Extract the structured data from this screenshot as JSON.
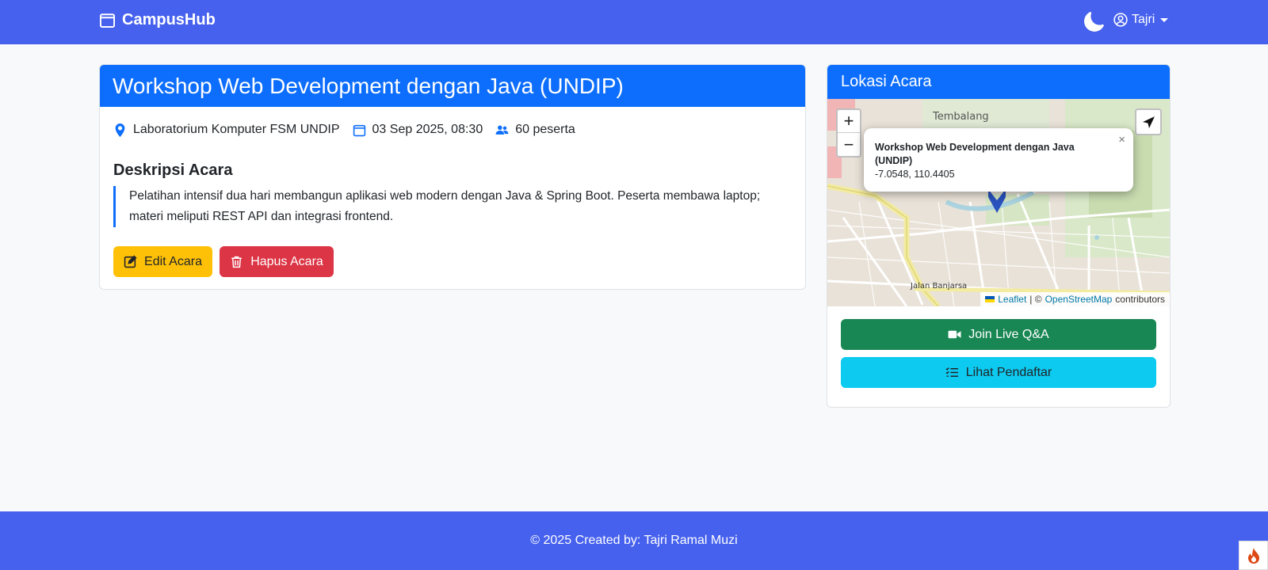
{
  "navbar": {
    "brand": "CampusHub",
    "brand_icon": "calendar-icon",
    "theme_icon": "moon-icon",
    "user_name": "Tajri",
    "user_icon": "user-circle-icon",
    "bg_color": "#4661ee"
  },
  "event": {
    "title": "Workshop Web Development dengan Java (UNDIP)",
    "location": "Laboratorium Komputer FSM UNDIP",
    "datetime": "03 Sep 2025, 08:30",
    "participants": "60 peserta",
    "description_title": "Deskripsi Acara",
    "description": "Pelatihan intensif dua hari membangun aplikasi web modern dengan Java & Spring Boot. Peserta membawa laptop; materi meliputi REST API dan integrasi frontend.",
    "edit_label": "Edit Acara",
    "delete_label": "Hapus Acara",
    "accent": "#0d6efd"
  },
  "location_card": {
    "title": "Lokasi Acara",
    "map": {
      "zoom_in": "+",
      "zoom_out": "−",
      "area_label": "Tembalang",
      "street_label": "Jalan Banjarsa",
      "popup_title": "Workshop Web Development dengan Java (UNDIP)",
      "popup_coords": "-7.0548, 110.4405",
      "popup_close": "×",
      "attribution_leaflet": "Leaflet",
      "attribution_sep": "| ©",
      "attribution_osm": "OpenStreetMap",
      "attribution_suffix": "contributors"
    },
    "live_label": "Join Live Q&A",
    "list_label": "Lihat Pendaftar"
  },
  "footer": {
    "text": "© 2025 Created by: Tajri Ramal Muzi"
  }
}
